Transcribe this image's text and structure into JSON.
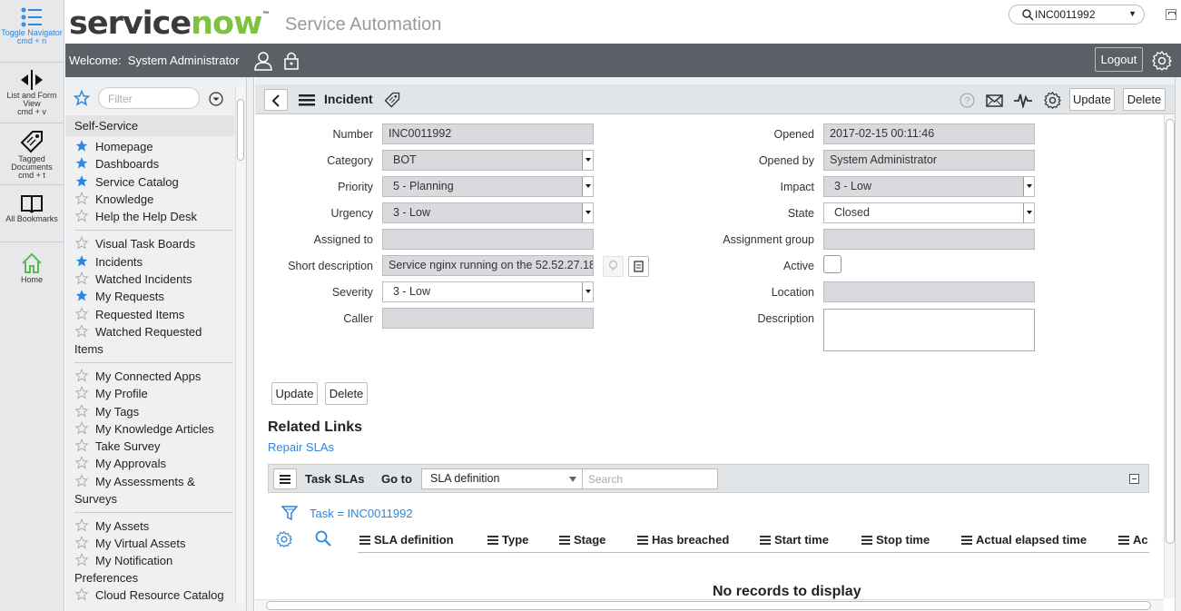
{
  "rail": {
    "items": [
      {
        "label": "Toggle Navigator",
        "shortcut": "cmd + n",
        "icon": "list-icon"
      },
      {
        "label": "List and Form View",
        "shortcut": "cmd + v",
        "icon": "split-view-icon"
      },
      {
        "label": "Tagged Documents",
        "shortcut": "cmd + t",
        "icon": "tag-icon"
      },
      {
        "label": "All Bookmarks",
        "icon": "book-icon"
      },
      {
        "label": "Home",
        "icon": "home-icon"
      }
    ]
  },
  "banner": {
    "logo_service": "service",
    "logo_now": "now",
    "logo_tm": "™",
    "title": "Service Automation",
    "search_value": "INC0011992"
  },
  "header": {
    "welcome_label": "Welcome:",
    "user": "System Administrator",
    "logout": "Logout"
  },
  "nav": {
    "filter_placeholder": "Filter",
    "section": "Self-Service",
    "items": [
      {
        "label": "Homepage",
        "starred": true
      },
      {
        "label": "Dashboards",
        "starred": true
      },
      {
        "label": "Service Catalog",
        "starred": true
      },
      {
        "label": "Knowledge",
        "starred": false
      },
      {
        "label": "Help the Help Desk",
        "starred": false
      },
      {
        "label": "Visual Task Boards",
        "starred": false
      },
      {
        "label": "Incidents",
        "starred": true
      },
      {
        "label": "Watched Incidents",
        "starred": false
      },
      {
        "label": "My Requests",
        "starred": true
      },
      {
        "label": "Requested Items",
        "starred": false
      },
      {
        "label": "Watched Requested Items",
        "starred": false
      },
      {
        "label": "My Connected Apps",
        "starred": false
      },
      {
        "label": "My Profile",
        "starred": false
      },
      {
        "label": "My Tags",
        "starred": false
      },
      {
        "label": "My Knowledge Articles",
        "starred": false
      },
      {
        "label": "Take Survey",
        "starred": false
      },
      {
        "label": "My Approvals",
        "starred": false
      },
      {
        "label": "My Assessments & Surveys",
        "starred": false
      },
      {
        "label": "My Assets",
        "starred": false
      },
      {
        "label": "My Virtual Assets",
        "starred": false
      },
      {
        "label": "My Notification Preferences",
        "starred": false
      },
      {
        "label": "Cloud Resource Catalog",
        "starred": false
      }
    ]
  },
  "form": {
    "title": "Incident",
    "update": "Update",
    "delete": "Delete",
    "labels": {
      "number": "Number",
      "category": "Category",
      "priority": "Priority",
      "urgency": "Urgency",
      "assigned_to": "Assigned to",
      "short_description": "Short description",
      "severity": "Severity",
      "caller": "Caller",
      "opened": "Opened",
      "opened_by": "Opened by",
      "impact": "Impact",
      "state": "State",
      "assignment_group": "Assignment group",
      "active": "Active",
      "location": "Location",
      "description": "Description"
    },
    "values": {
      "number": "INC0011992",
      "category": "BOT",
      "priority": "5 - Planning",
      "urgency": "3 - Low",
      "assigned_to": "",
      "short_description": "Service nginx running on the 52.52.27.18",
      "severity": "3 - Low",
      "caller": "",
      "opened": "2017-02-15 00:11:46",
      "opened_by": "System Administrator",
      "impact": "3 - Low",
      "state": "Closed",
      "assignment_group": "",
      "active": false,
      "location": "",
      "description": ""
    }
  },
  "related": {
    "title": "Related Links",
    "link": "Repair SLAs"
  },
  "task_slas": {
    "title": "Task SLAs",
    "goto_label": "Go to",
    "goto_value": "SLA definition",
    "search_placeholder": "Search",
    "filter_text": "Task = INC0011992",
    "columns": [
      "SLA definition",
      "Type",
      "Stage",
      "Has breached",
      "Start time",
      "Stop time",
      "Actual elapsed time",
      "Ac"
    ],
    "empty": "No records to display"
  },
  "colors": {
    "brand_green": "#7fc241",
    "header_bar": "#5b6066",
    "link_blue": "#2e86de",
    "star_blue": "#2e86de"
  }
}
